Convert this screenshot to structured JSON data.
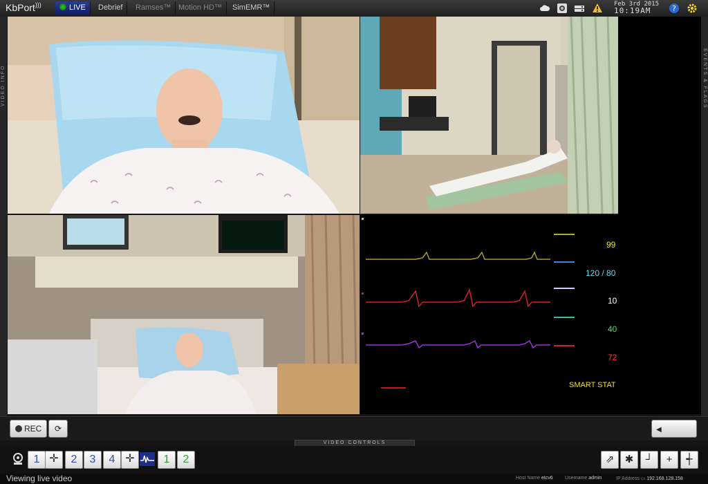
{
  "app": {
    "logo": "KbPort"
  },
  "tabs": [
    {
      "label": "LIVE",
      "active": true
    },
    {
      "label": "Debrief",
      "active": false
    },
    {
      "label": "Ramses™",
      "active": false
    },
    {
      "label": "Motion HD™",
      "active": false
    },
    {
      "label": "SimEMR™",
      "active": false
    }
  ],
  "header": {
    "date": "Feb 3rd 2015",
    "time": "10:19AM",
    "icons": [
      "cloud-icon",
      "camera-icon",
      "drive-icon",
      "warning-icon",
      "help-icon",
      "settings-icon"
    ]
  },
  "side": {
    "left_label": "VIDEO INFO",
    "right_label": "EVENTS & FLAGS"
  },
  "monitor": {
    "vitals": [
      {
        "value": "99",
        "color": "#e8e83a"
      },
      {
        "value": "120 / 80",
        "color": "#5ad8e8"
      },
      {
        "value": "10",
        "color": "#ffffff"
      },
      {
        "value": "40",
        "color": "#44e06a"
      },
      {
        "value": "72",
        "color": "#ff3a2a"
      }
    ],
    "status_text": "SMART STAT",
    "status_color": "#f0e020",
    "waveform_colors": [
      "#a8a020",
      "#d8202a",
      "#9a30d8"
    ]
  },
  "controls": {
    "rec_label": "REC",
    "video_controls_label": "VIDEO CONTROLS",
    "camera_buttons": [
      "1",
      "2",
      "3",
      "4"
    ],
    "vitals_buttons": [
      "1",
      "2"
    ]
  },
  "status_bar": {
    "message": "Viewing live video",
    "host_label": "Host Name",
    "host_value": "etcv6",
    "user_label": "Username",
    "user_value": "admin",
    "ip_label": "IP Address",
    "ip_value": "192.168.128.158"
  },
  "colors": {
    "accent_live": "#1e2f8a",
    "camera_number": "#2a4fb5",
    "vitals_number": "#2fa12f"
  }
}
